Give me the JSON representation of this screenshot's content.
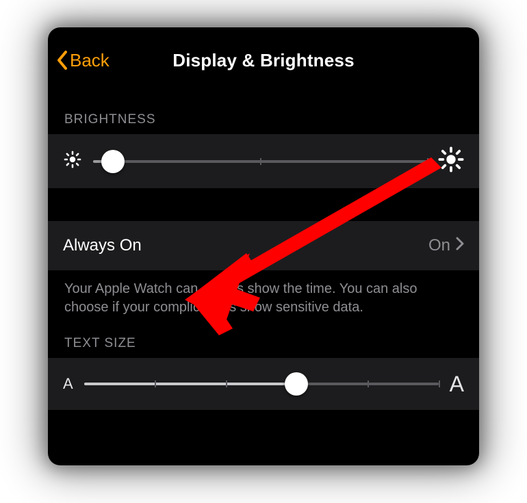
{
  "header": {
    "back_label": "Back",
    "title": "Display & Brightness"
  },
  "brightness": {
    "section_label": "BRIGHTNESS",
    "small_icon": "sun-dim-icon",
    "large_icon": "sun-bright-icon",
    "value_percent": 6,
    "ticks": [
      50,
      100
    ]
  },
  "always_on": {
    "label": "Always On",
    "value": "On",
    "description": "Your Apple Watch can always show the time. You can also choose if your complications show sensitive data."
  },
  "text_size": {
    "section_label": "TEXT SIZE",
    "small_letter": "A",
    "large_letter": "A",
    "value_percent": 60,
    "ticks": [
      20,
      40,
      80,
      100
    ]
  },
  "colors": {
    "accent": "#ff9f0a",
    "cell_bg": "#1c1c1e",
    "secondary_text": "#8e8e93",
    "annotation_arrow": "#ff0000"
  }
}
